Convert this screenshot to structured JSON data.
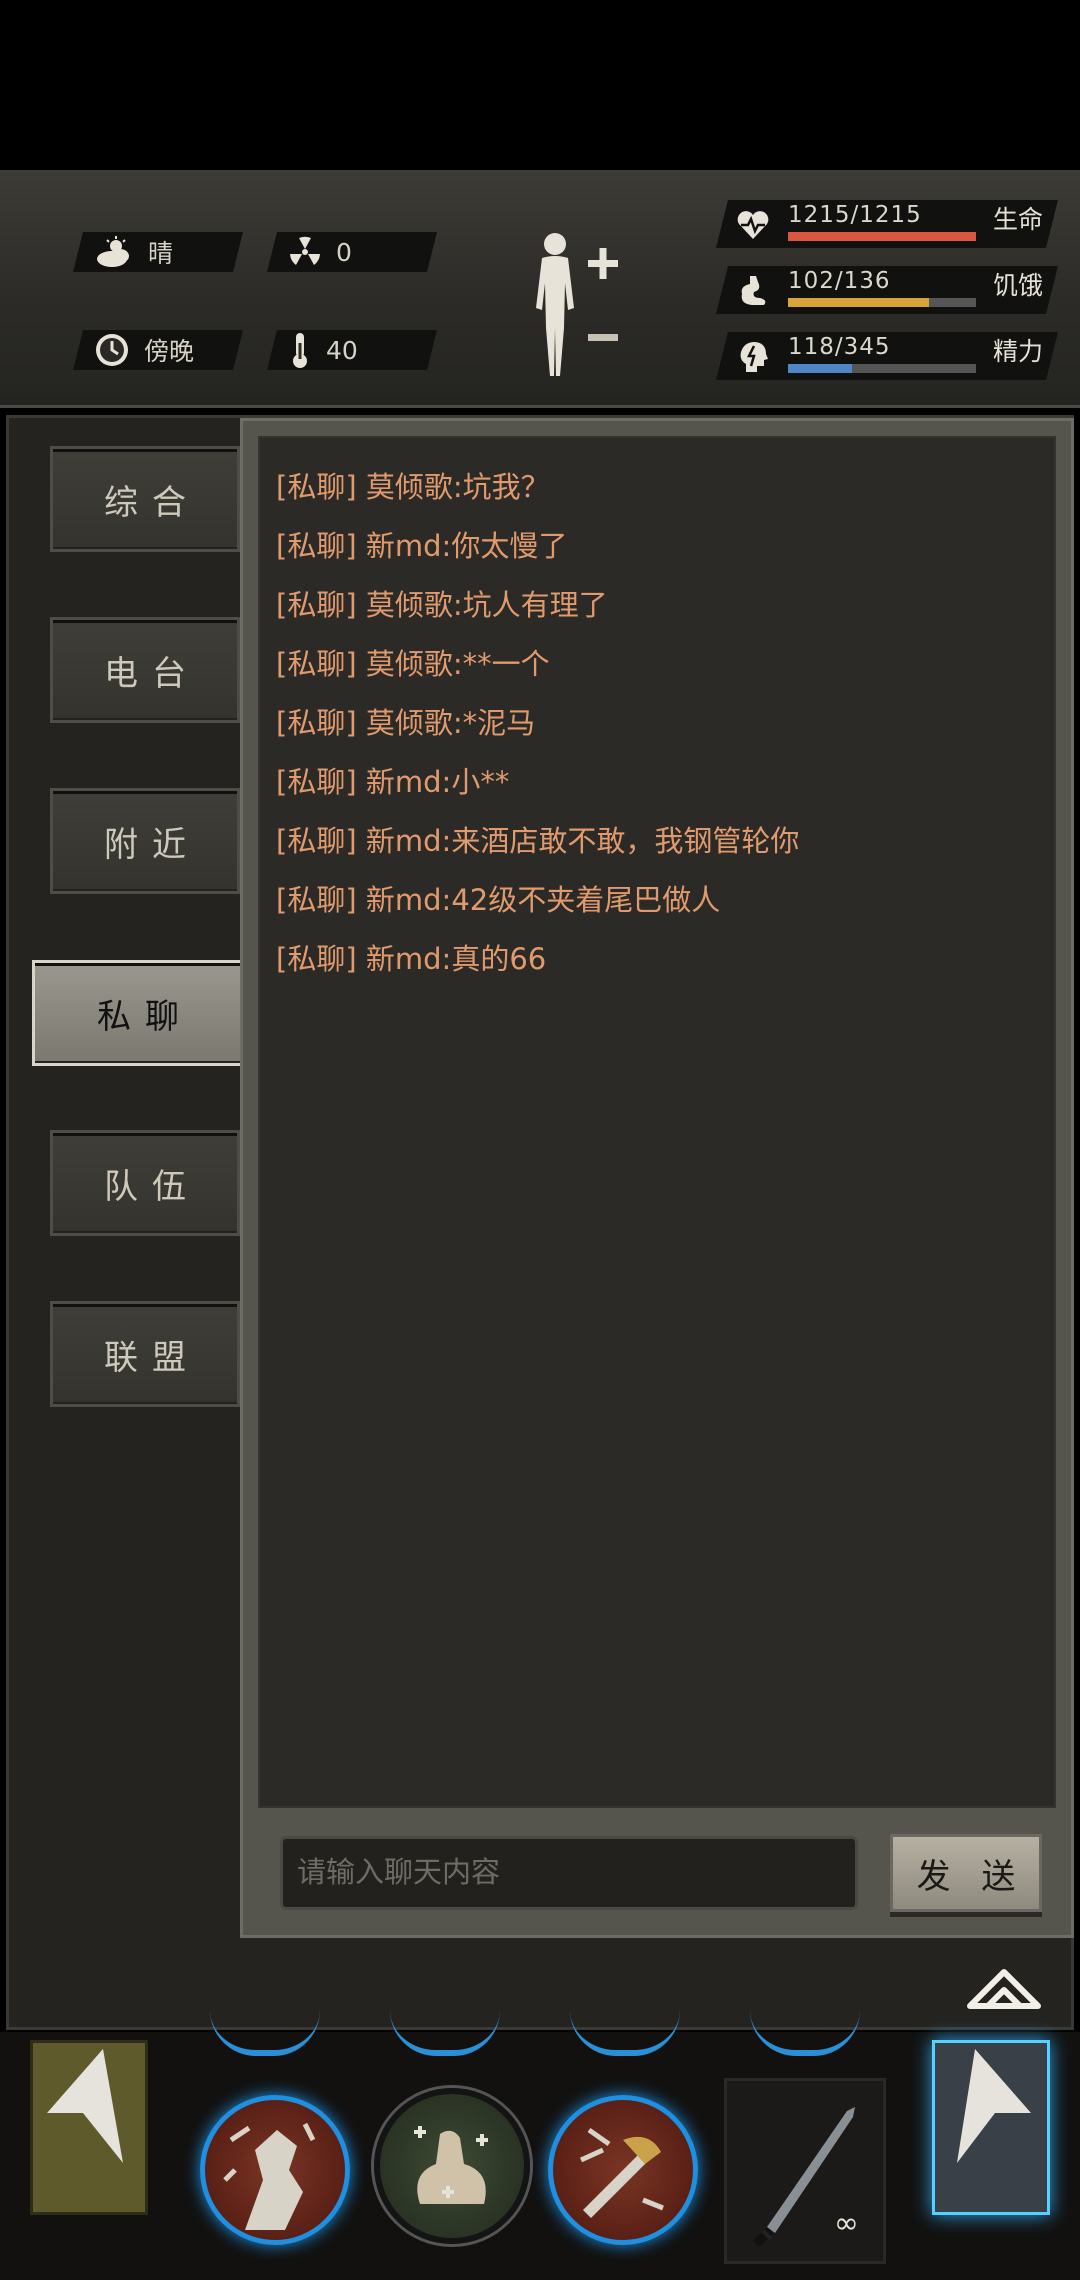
{
  "hud": {
    "weather": "晴",
    "radiation": "0",
    "time_of_day": "傍晚",
    "temperature": "40",
    "stats": [
      {
        "name": "health",
        "label": "生命",
        "value_text": "1215/1215",
        "current": 1215,
        "max": 1215,
        "color": "#d9573f"
      },
      {
        "name": "hunger",
        "label": "饥饿",
        "value_text": "102/136",
        "current": 102,
        "max": 136,
        "color": "#d7a33a"
      },
      {
        "name": "energy",
        "label": "精力",
        "value_text": "118/345",
        "current": 118,
        "max": 345,
        "color": "#4f86c6"
      }
    ]
  },
  "tabs": [
    {
      "label": "综合",
      "active": false
    },
    {
      "label": "电台",
      "active": false
    },
    {
      "label": "附近",
      "active": false
    },
    {
      "label": "私聊",
      "active": true
    },
    {
      "label": "队伍",
      "active": false
    },
    {
      "label": "联盟",
      "active": false
    }
  ],
  "messages": [
    {
      "channel": "[私聊]",
      "sender": "莫倾歌",
      "text": "坑我？"
    },
    {
      "channel": "[私聊]",
      "sender": "新md",
      "text": "你太慢了"
    },
    {
      "channel": "[私聊]",
      "sender": "莫倾歌",
      "text": "坑人有理了"
    },
    {
      "channel": "[私聊]",
      "sender": "莫倾歌",
      "text": "**一个"
    },
    {
      "channel": "[私聊]",
      "sender": "莫倾歌",
      "text": "*泥马"
    },
    {
      "channel": "[私聊]",
      "sender": "新md",
      "text": "小**"
    },
    {
      "channel": "[私聊]",
      "sender": "新md",
      "text": "来酒店敢不敢，我钢管轮你"
    },
    {
      "channel": "[私聊]",
      "sender": "新md",
      "text": "42级不夹着尾巴做人"
    },
    {
      "channel": "[私聊]",
      "sender": "新md",
      "text": "真的66"
    }
  ],
  "chat_input": {
    "placeholder": "请输入聊天内容",
    "value": ""
  },
  "send_label": "发 送",
  "weapon": {
    "count": "∞"
  }
}
